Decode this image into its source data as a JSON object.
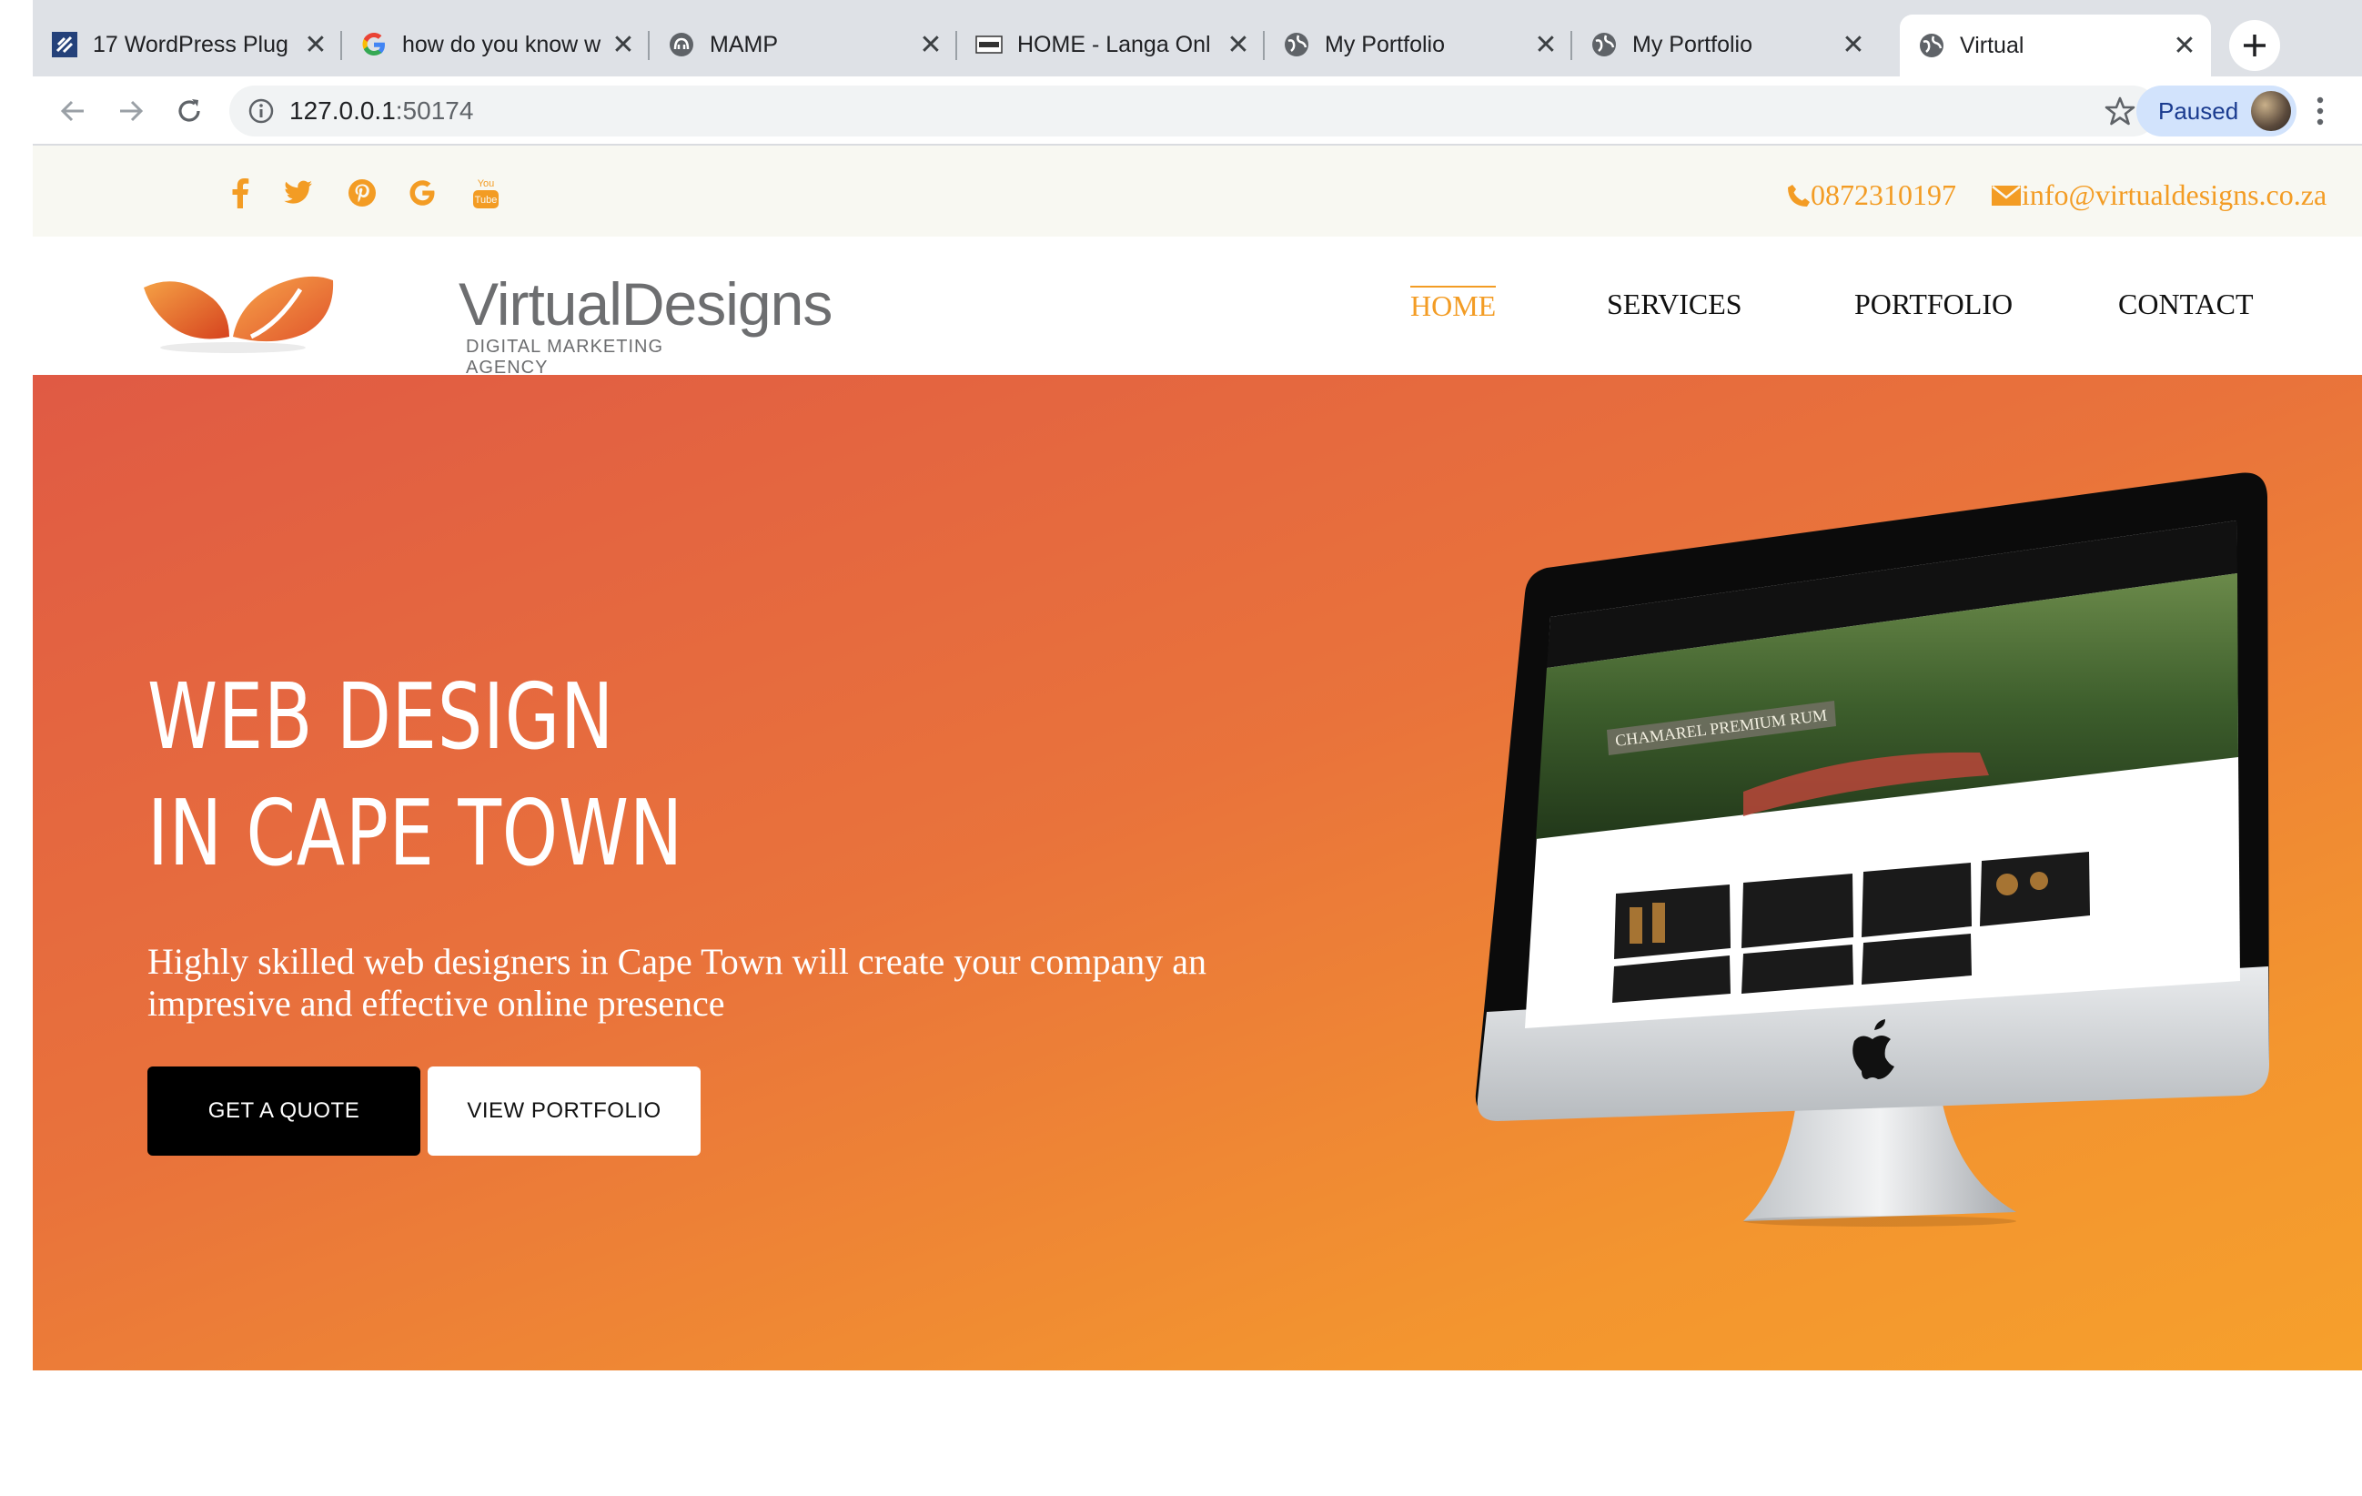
{
  "browser": {
    "tabs": [
      {
        "title": "17 WordPress Plug",
        "icon": "wordpress-plugin-icon",
        "active": false
      },
      {
        "title": "how do you know w",
        "icon": "google-icon",
        "active": false
      },
      {
        "title": "MAMP",
        "icon": "mamp-elephant-icon",
        "active": false
      },
      {
        "title": "HOME - Langa Onl",
        "icon": "langa-icon",
        "active": false
      },
      {
        "title": "My Portfolio",
        "icon": "globe-icon",
        "active": false
      },
      {
        "title": "My Portfolio",
        "icon": "globe-icon",
        "active": false
      },
      {
        "title": "Virtual",
        "icon": "globe-icon",
        "active": true
      }
    ],
    "url_host": "127.0.0.1",
    "url_port": ":50174",
    "profile_label": "Paused"
  },
  "topbar": {
    "social": [
      "facebook-icon",
      "twitter-icon",
      "pinterest-icon",
      "google-icon",
      "youtube-icon"
    ],
    "youtube_text_top": "You",
    "youtube_text_bottom": "Tube",
    "phone": "0872310197",
    "email": "info@virtualdesigns.co.za",
    "accent": "#f39c24"
  },
  "header": {
    "brand": "VirtualDesigns",
    "tagline": "DIGITAL MARKETING AGENCY",
    "nav": [
      "HOME",
      "SERVICES",
      "PORTFOLIO",
      "CONTACT"
    ],
    "active_nav": "HOME"
  },
  "hero": {
    "title_line1": "WEB DESIGN",
    "title_line2": "IN CAPE TOWN",
    "lead": "Highly skilled web designers in Cape Town will create your company an impresive and effective online presence",
    "cta_primary": "GET A QUOTE",
    "cta_secondary": "VIEW PORTFOLIO",
    "gradient_start": "#e05a44",
    "gradient_end": "#f6a02c",
    "screen_banner": "CHAMAREL PREMIUM RUM"
  }
}
